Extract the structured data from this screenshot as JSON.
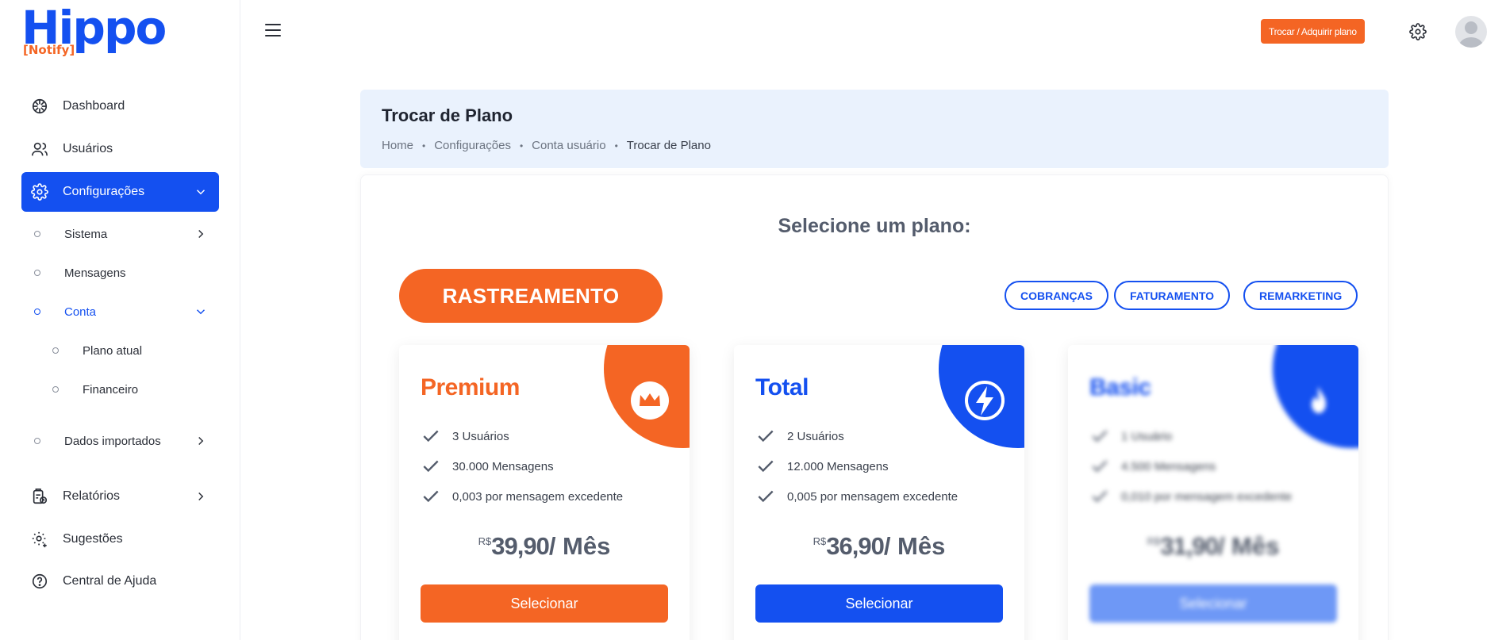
{
  "brand": {
    "name": "Hippo",
    "sub": "[Notify]",
    "color": "#1450f0",
    "accent": "#f46524"
  },
  "sidebar": {
    "items": [
      {
        "label": "Dashboard",
        "icon": "dashboard-icon"
      },
      {
        "label": "Usuários",
        "icon": "users-icon"
      },
      {
        "label": "Configurações",
        "icon": "settings-icon",
        "active": true
      },
      {
        "label": "Relatórios",
        "icon": "report-icon"
      },
      {
        "label": "Sugestões",
        "icon": "suggestions-icon"
      },
      {
        "label": "Central de Ajuda",
        "icon": "help-icon"
      }
    ],
    "sub": [
      {
        "label": "Sistema"
      },
      {
        "label": "Mensagens"
      },
      {
        "label": "Conta"
      },
      {
        "label": "Dados importados"
      }
    ],
    "subsub": [
      {
        "label": "Plano atual"
      },
      {
        "label": "Financeiro"
      }
    ]
  },
  "topbar": {
    "upgrade_label": "Trocar / Adquirir plano"
  },
  "header": {
    "title": "Trocar de Plano",
    "breadcrumb": [
      "Home",
      "Configurações",
      "Conta usuário",
      "Trocar de Plano"
    ]
  },
  "main": {
    "select_title": "Selecione um plano:",
    "categories": [
      "RASTREAMENTO",
      "COBRANÇAS",
      "FATURAMENTO",
      "REMARKETING"
    ],
    "plans": [
      {
        "name": "Premium",
        "color": "#f46524",
        "icon": "crown-icon",
        "features": [
          "3 Usuários",
          "30.000 Mensagens",
          "0,003 por mensagem excedente"
        ],
        "currency": "R$",
        "price": "39,90",
        "period": "/ Mês",
        "button": "Selecionar"
      },
      {
        "name": "Total",
        "color": "#1450f0",
        "icon": "lightning-icon",
        "features": [
          "2 Usuários",
          "12.000 Mensagens",
          "0,005 por mensagem excedente"
        ],
        "currency": "R$",
        "price": "36,90",
        "period": "/ Mês",
        "button": "Selecionar"
      },
      {
        "name": "Basic",
        "color": "#1450f0",
        "icon": "flame-icon",
        "blurred": true,
        "features": [
          "1 Usuário",
          "4.500 Mensagens",
          "0,010 por mensagem excedente"
        ],
        "currency": "R$",
        "price": "31,90",
        "period": "/ Mês",
        "button": "Selecionar"
      }
    ]
  }
}
